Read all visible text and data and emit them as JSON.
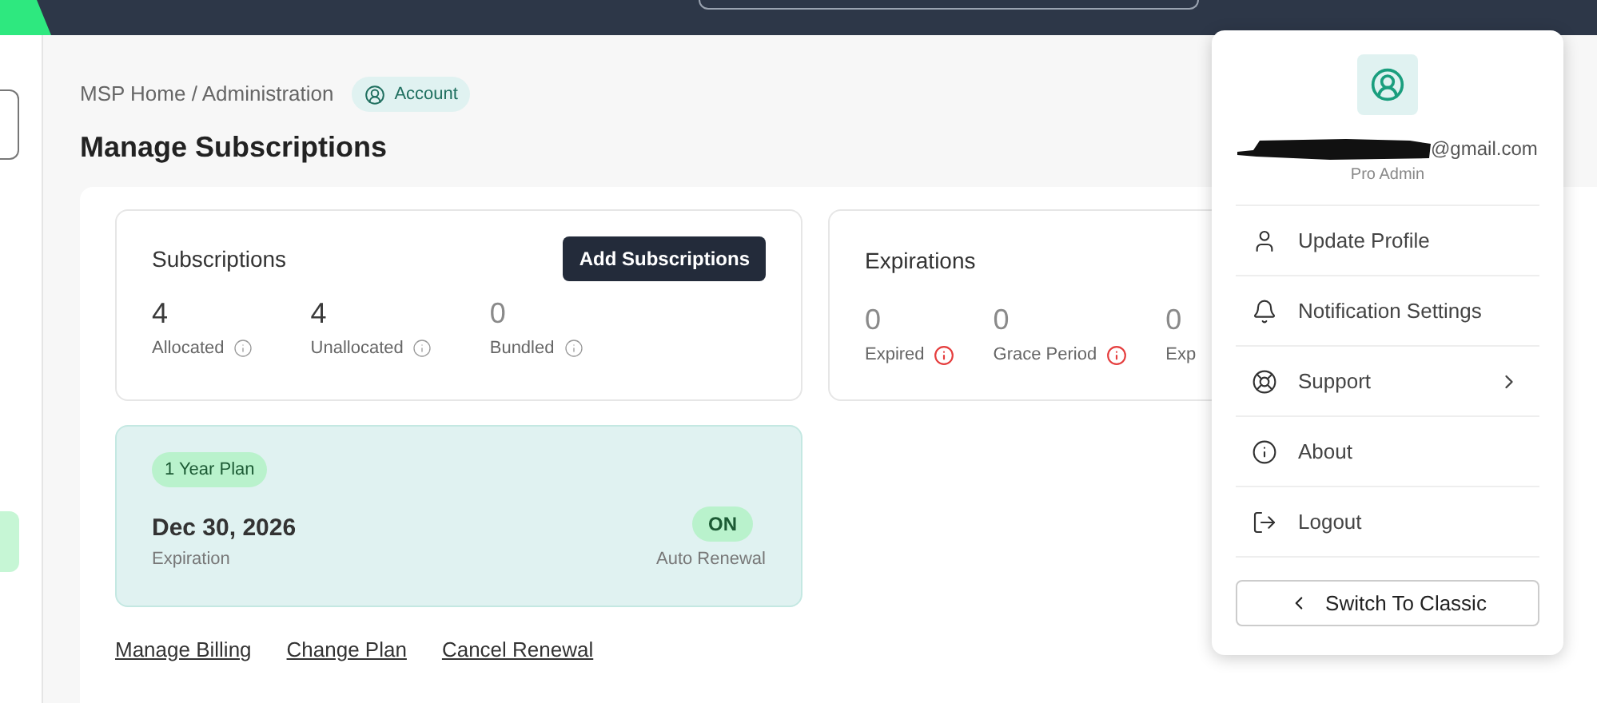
{
  "breadcrumb": {
    "path": "MSP Home / Administration",
    "badge": "Account"
  },
  "page_title": "Manage Subscriptions",
  "subscriptions": {
    "title": "Subscriptions",
    "button": "Add Subscriptions",
    "stats": [
      {
        "value": "4",
        "label": "Allocated",
        "alert": false
      },
      {
        "value": "4",
        "label": "Unallocated",
        "alert": false
      },
      {
        "value": "0",
        "label": "Bundled",
        "alert": false
      }
    ]
  },
  "expirations": {
    "title": "Expirations",
    "stats": [
      {
        "value": "0",
        "label": "Expired",
        "alert": true
      },
      {
        "value": "0",
        "label": "Grace Period",
        "alert": true
      },
      {
        "value": "0",
        "label": "Exp"
      }
    ]
  },
  "plan": {
    "badge": "1 Year Plan",
    "date": "Dec 30, 2026",
    "date_label": "Expiration",
    "renewal_status": "ON",
    "renewal_label": "Auto Renewal"
  },
  "links": [
    "Manage Billing",
    "Change Plan",
    "Cancel Renewal"
  ],
  "profile_menu": {
    "email": "@gmail.com",
    "role": "Pro Admin",
    "items": [
      {
        "kind": "profile",
        "label": "Update Profile",
        "submenu": false
      },
      {
        "kind": "notifications",
        "label": "Notification Settings",
        "submenu": false
      },
      {
        "kind": "support",
        "label": "Support",
        "submenu": true
      },
      {
        "kind": "about",
        "label": "About",
        "submenu": false
      },
      {
        "kind": "logout",
        "label": "Logout",
        "submenu": false
      }
    ],
    "footer_button": "Switch To Classic"
  }
}
